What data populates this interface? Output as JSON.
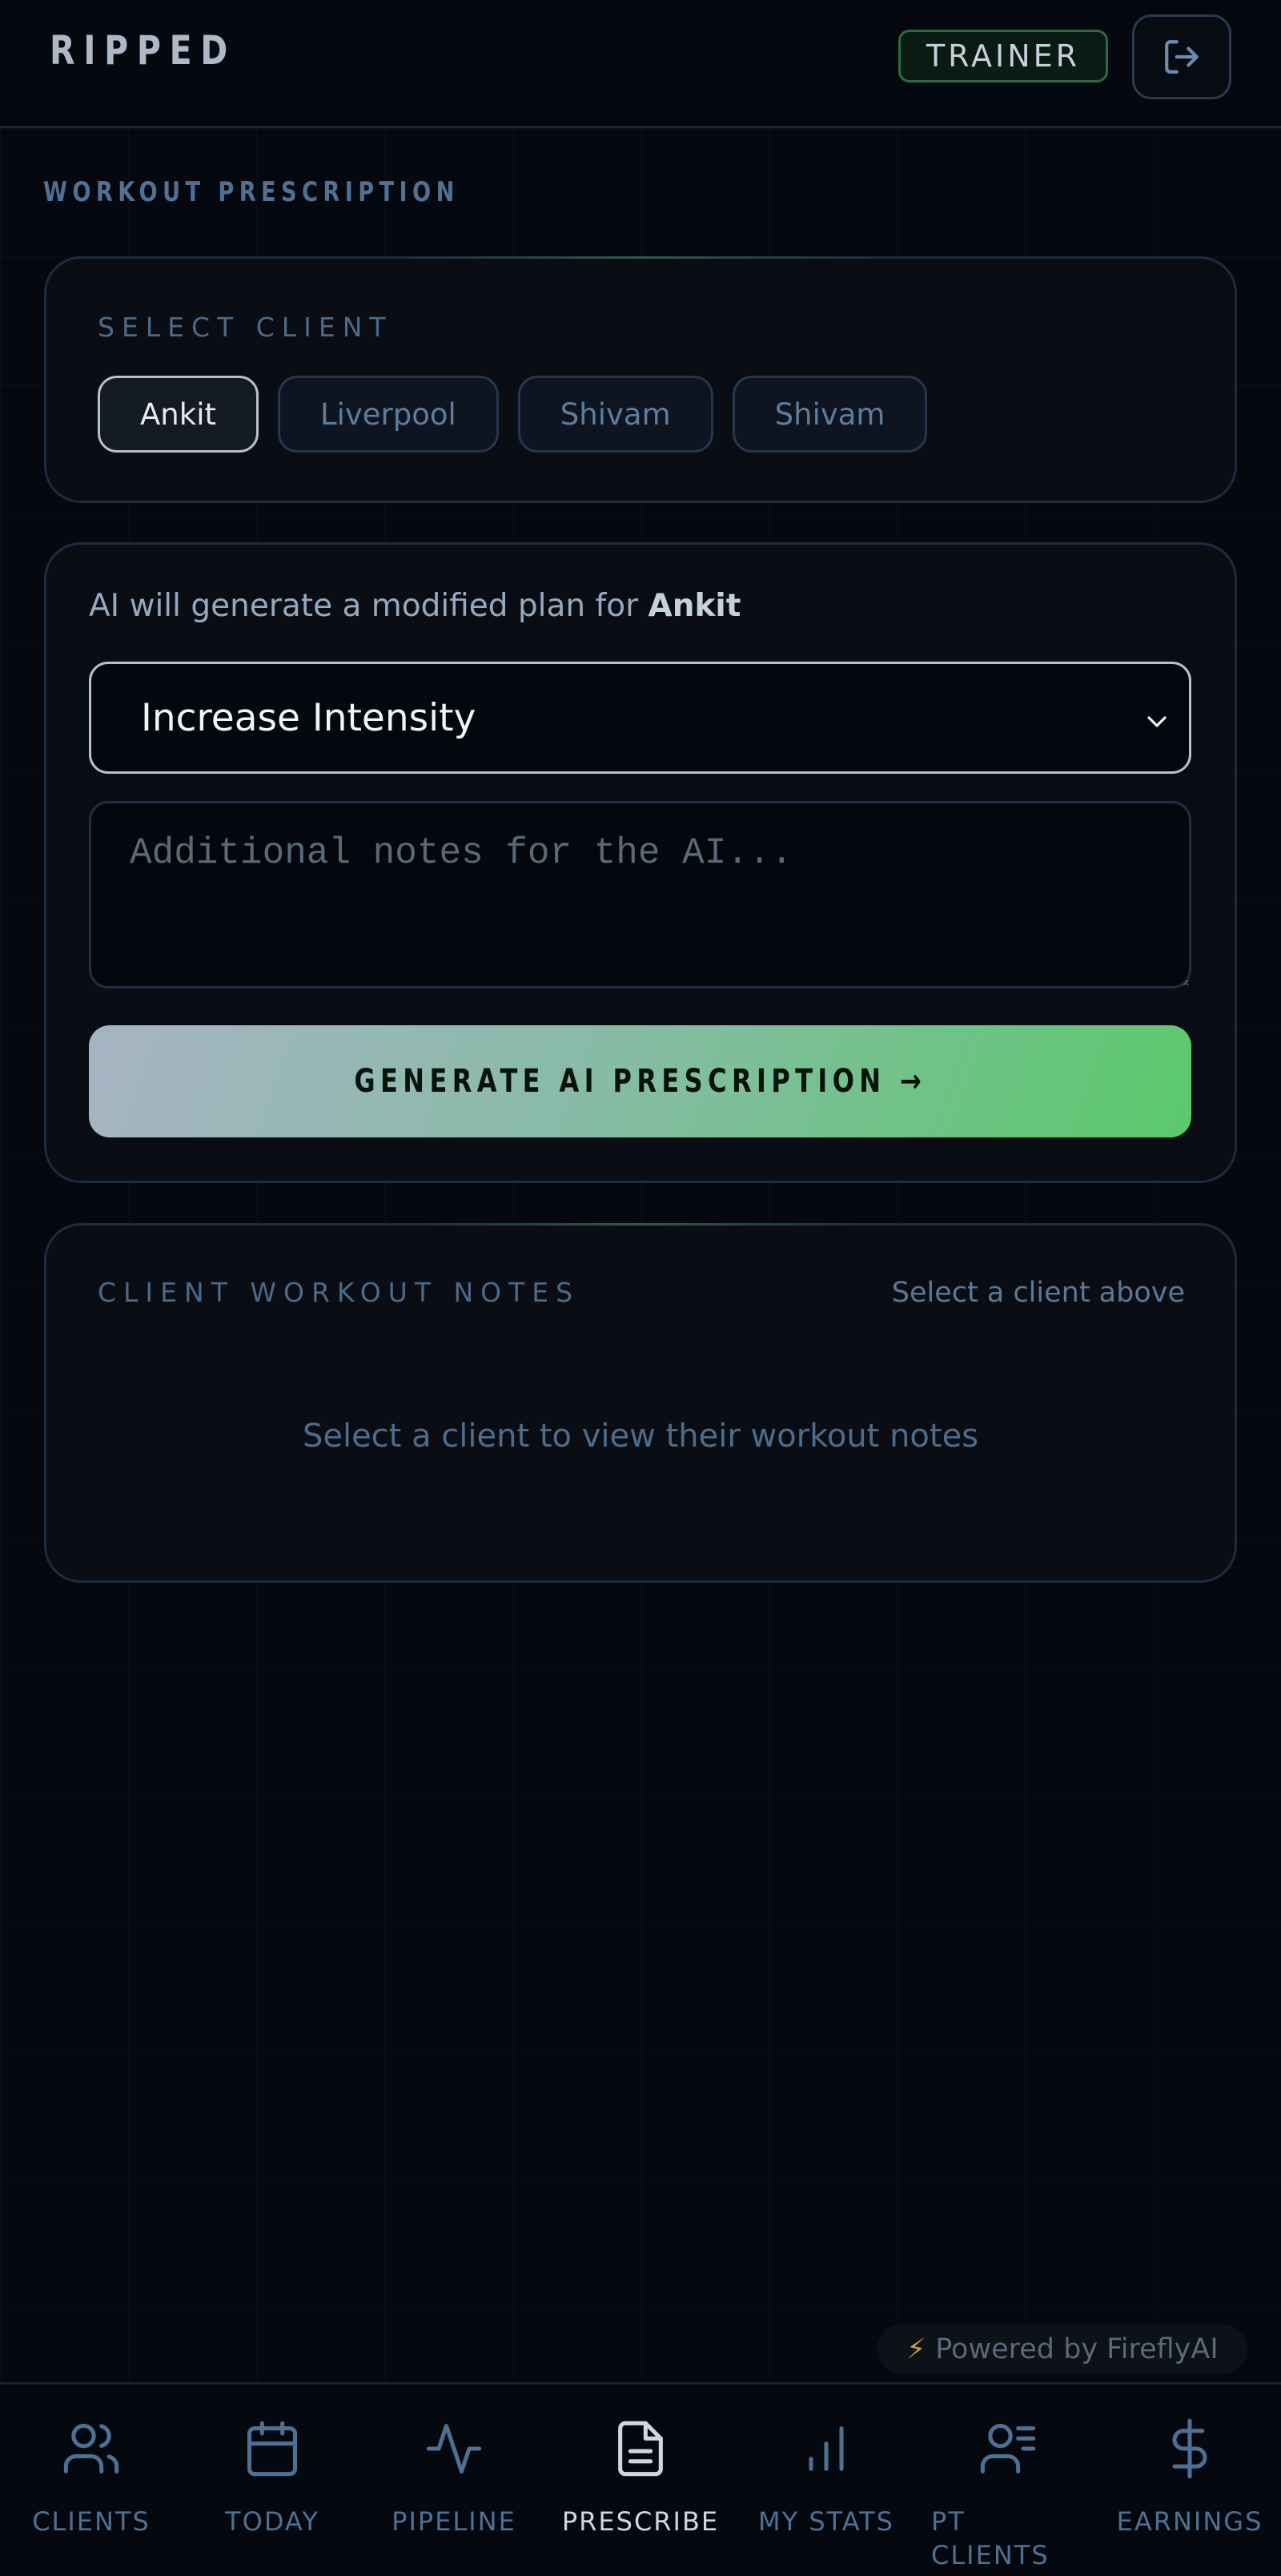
{
  "header": {
    "logo": "RIPPED",
    "role_badge": "TRAINER",
    "logout_icon": "logout-icon"
  },
  "page": {
    "title": "WORKOUT PRESCRIPTION"
  },
  "select_client": {
    "label": "SELECT CLIENT",
    "clients": [
      "Ankit",
      "Liverpool",
      "Shivam",
      "Shivam"
    ],
    "selected": "Ankit"
  },
  "prescription": {
    "intro_prefix": "AI will generate a modified plan for",
    "client_name": "Ankit",
    "mode_value": "Increase Intensity",
    "notes_placeholder": "Additional notes for the AI...",
    "generate_label": "GENERATE AI PRESCRIPTION →"
  },
  "workout_notes": {
    "label": "CLIENT WORKOUT NOTES",
    "hint": "Select a client above",
    "empty_message": "Select a client to view their workout notes"
  },
  "powered_by": {
    "bolt": "⚡",
    "text": "Powered by FireflyAI"
  },
  "nav": {
    "active": "PRESCRIBE",
    "items": [
      {
        "label": "CLIENTS",
        "icon": "users-icon"
      },
      {
        "label": "TODAY",
        "icon": "calendar-icon"
      },
      {
        "label": "PIPELINE",
        "icon": "activity-icon"
      },
      {
        "label": "PRESCRIBE",
        "icon": "file-text-icon"
      },
      {
        "label": "MY STATS",
        "icon": "bar-chart-icon"
      },
      {
        "label": "PT CLIENTS",
        "icon": "user-list-icon"
      },
      {
        "label": "EARNINGS",
        "icon": "dollar-icon"
      }
    ]
  },
  "colors": {
    "background": "#05080f",
    "accent_green": "#5bc96c",
    "muted_blue": "#4d7195"
  }
}
